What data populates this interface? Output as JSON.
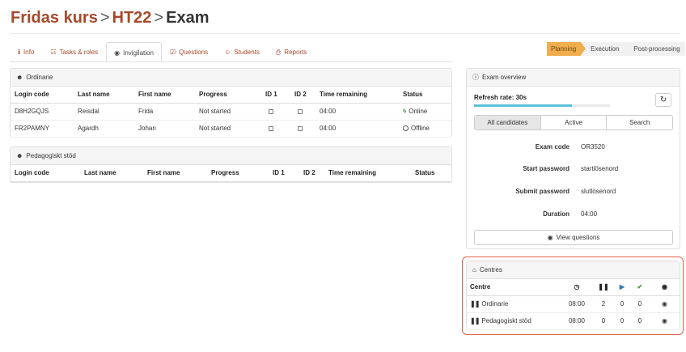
{
  "breadcrumb": {
    "course": "Fridas kurs",
    "term": "HT22",
    "current": "Exam",
    "separator": ">"
  },
  "tabs": [
    {
      "icon": "ℹ",
      "label": "Info"
    },
    {
      "icon": "☷",
      "label": "Tasks & roles"
    },
    {
      "icon": "◉",
      "label": "Invigilation"
    },
    {
      "icon": "☑",
      "label": "Questions"
    },
    {
      "icon": "☺",
      "label": "Students"
    },
    {
      "icon": "⎙",
      "label": "Reports"
    }
  ],
  "active_tab": "Invigilation",
  "phases": [
    "Planning",
    "Execution",
    "Post-processing"
  ],
  "ordinarie": {
    "title": "Ordinarie",
    "columns": [
      "Login code",
      "Last name",
      "First name",
      "Progress",
      "ID 1",
      "ID 2",
      "Time remaining",
      "Status"
    ],
    "rows": [
      {
        "login": "D8H2GQJS",
        "last": "Reisdal",
        "first": "Frida",
        "progress": "Not started",
        "time": "04:00",
        "status": "Online"
      },
      {
        "login": "FR2PAMNY",
        "last": "Agardh",
        "first": "Johan",
        "progress": "Not started",
        "time": "04:00",
        "status": "Offline"
      }
    ]
  },
  "pedagogiskt": {
    "title": "Pedagogiskt stöd",
    "columns": [
      "Login code",
      "Last name",
      "First name",
      "Progress",
      "ID 1",
      "ID 2",
      "Time remaining",
      "Status"
    ]
  },
  "overview": {
    "title": "Exam overview",
    "refresh_label": "Refresh rate: 30s",
    "refresh_progress": 0.72,
    "filters": [
      "All candidates",
      "Active",
      "Search"
    ],
    "fields": [
      {
        "key": "Exam code",
        "value": "OR3520"
      },
      {
        "key": "Start password",
        "value": "startlösenord"
      },
      {
        "key": "Submit password",
        "value": "slutlösenord"
      },
      {
        "key": "Duration",
        "value": "04:00"
      }
    ],
    "view_questions": "View questions"
  },
  "centres": {
    "title": "Centres",
    "column_label": "Centre",
    "rows": [
      {
        "name": "Ordinarie",
        "time": "08:00",
        "paused": "2",
        "active": "0",
        "done": "0"
      },
      {
        "name": "Pedagogiskt stöd",
        "time": "08:00",
        "paused": "0",
        "active": "0",
        "done": "0"
      }
    ]
  },
  "colors": {
    "brand": "#a5492a",
    "planning": "#f0ad4e",
    "progress": "#5bc0de",
    "online": "#2a8a2a",
    "highlight": "#e06050"
  }
}
